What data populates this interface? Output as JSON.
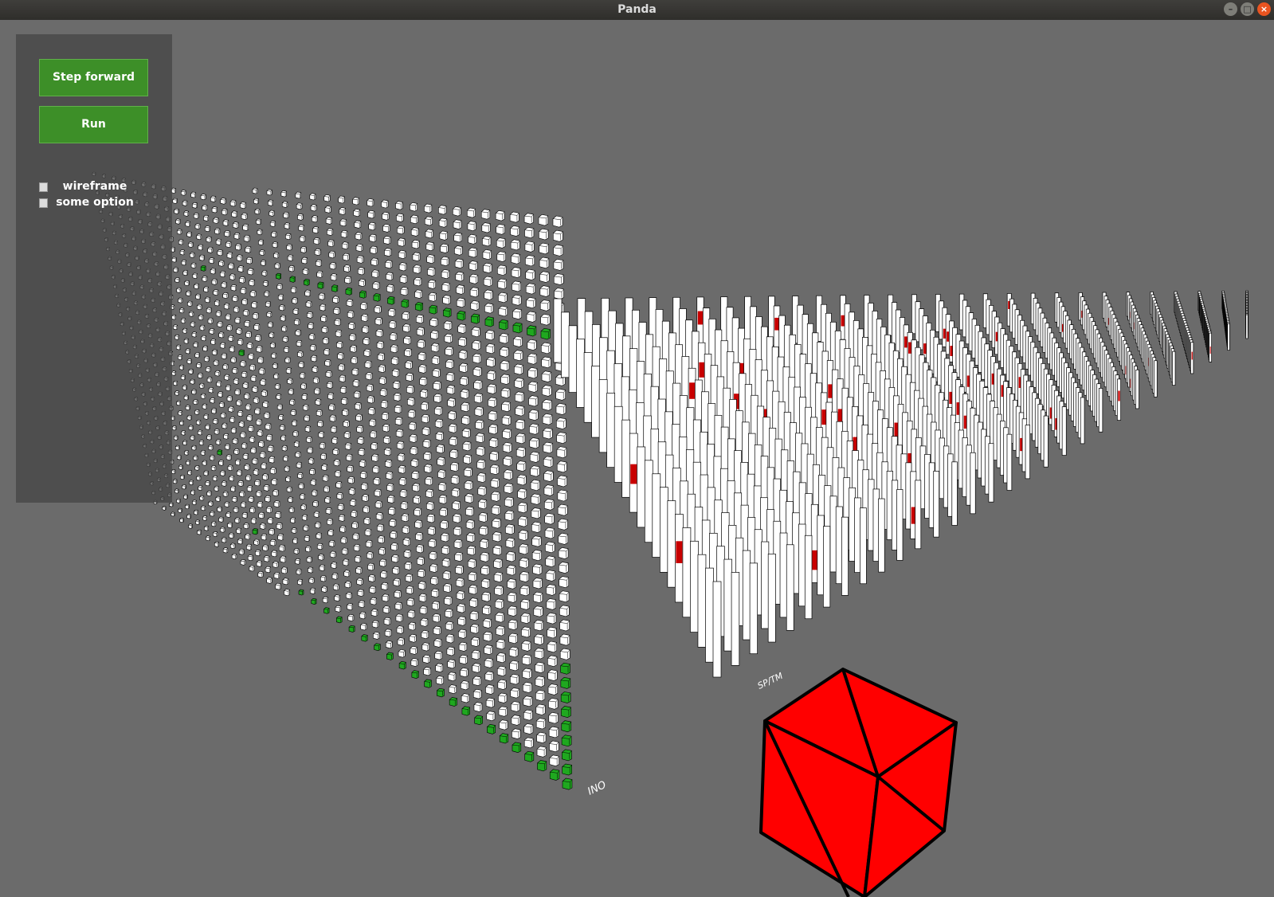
{
  "window": {
    "title": "Panda",
    "buttons": [
      "–",
      "□",
      "×"
    ]
  },
  "panel": {
    "step_forward_label": "Step forward",
    "run_label": "Run",
    "options": [
      {
        "label": "wireframe",
        "checked": false
      },
      {
        "label": "some option",
        "checked": false
      }
    ]
  },
  "scene": {
    "labels": {
      "input": "INO",
      "region": "SP/TM"
    },
    "colors": {
      "background": "#6b6b6b",
      "active": "#1fa81f",
      "predictive": "#c80000",
      "inactive": "#ffffff",
      "cube": "#ff0000"
    }
  }
}
